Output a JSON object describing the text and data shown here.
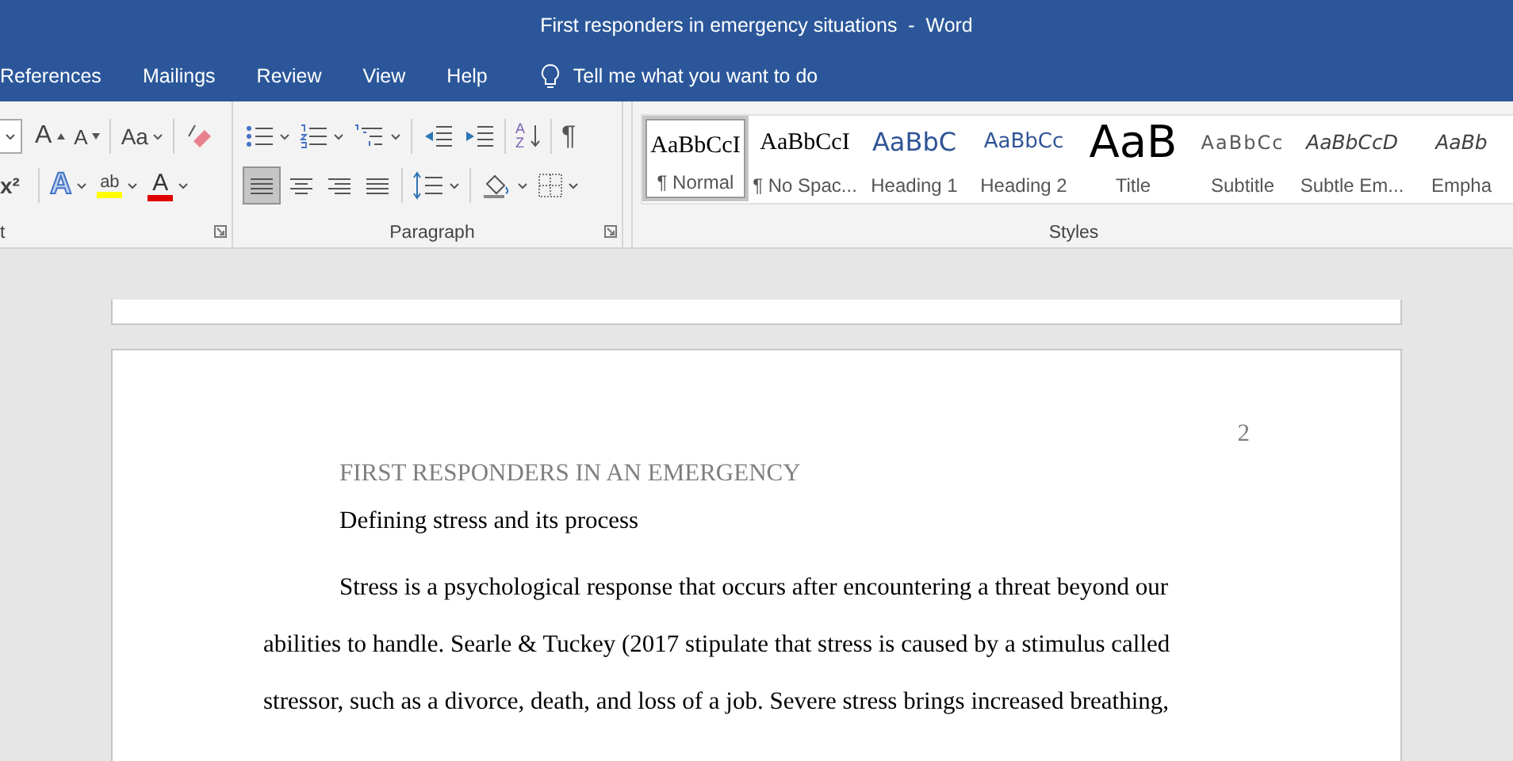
{
  "window": {
    "title": "First responders in emergency situations  -  Word"
  },
  "menu_tabs": [
    "References",
    "Mailings",
    "Review",
    "View",
    "Help"
  ],
  "tell_me": "Tell me what you want to do",
  "font_group": {
    "label": "t",
    "grow_font": "A",
    "shrink_font": "A",
    "change_case": "Aa",
    "superscript": "x²",
    "text_effects": "A",
    "highlight": "ab",
    "font_color": "A"
  },
  "paragraph_group": {
    "label": "Paragraph",
    "sort": [
      "A",
      "Z"
    ],
    "show_marks": "¶",
    "alignment": [
      {
        "kind": "left",
        "selected": true
      },
      {
        "kind": "center",
        "selected": false
      },
      {
        "kind": "right",
        "selected": false
      },
      {
        "kind": "justify",
        "selected": false
      }
    ]
  },
  "styles_group": {
    "label": "Styles",
    "styles": [
      {
        "kind": "normal",
        "preview": "AaBbCcI",
        "label": "¶ Normal",
        "selected": true
      },
      {
        "kind": "normal",
        "preview": "AaBbCcI",
        "label": "¶ No Spac...",
        "selected": false
      },
      {
        "kind": "heading1",
        "preview": "AaBbC",
        "label": "Heading 1",
        "selected": false
      },
      {
        "kind": "heading2",
        "preview": "AaBbCc",
        "label": "Heading 2",
        "selected": false
      },
      {
        "kind": "title",
        "preview": "AaB",
        "label": "Title",
        "selected": false
      },
      {
        "kind": "subtitle",
        "preview": "AaBbCc",
        "label": "Subtitle",
        "selected": false
      },
      {
        "kind": "emphasis",
        "preview": "AaBbCcD",
        "label": "Subtle Em...",
        "selected": false
      },
      {
        "kind": "emphasis",
        "preview": "AaBb",
        "label": "Empha",
        "selected": false
      }
    ]
  },
  "document": {
    "page_number": "2",
    "running_head": "FIRST RESPONDERS IN AN EMERGENCY",
    "heading": "Defining stress and its process",
    "paragraph_lines": [
      "Stress is a psychological response that occurs after encountering a threat beyond our",
      "abilities to handle. Searle & Tuckey (2017 stipulate that stress is caused by a stimulus called",
      "stressor, such as a divorce, death, and loss of a job. Severe stress brings increased breathing,"
    ]
  }
}
